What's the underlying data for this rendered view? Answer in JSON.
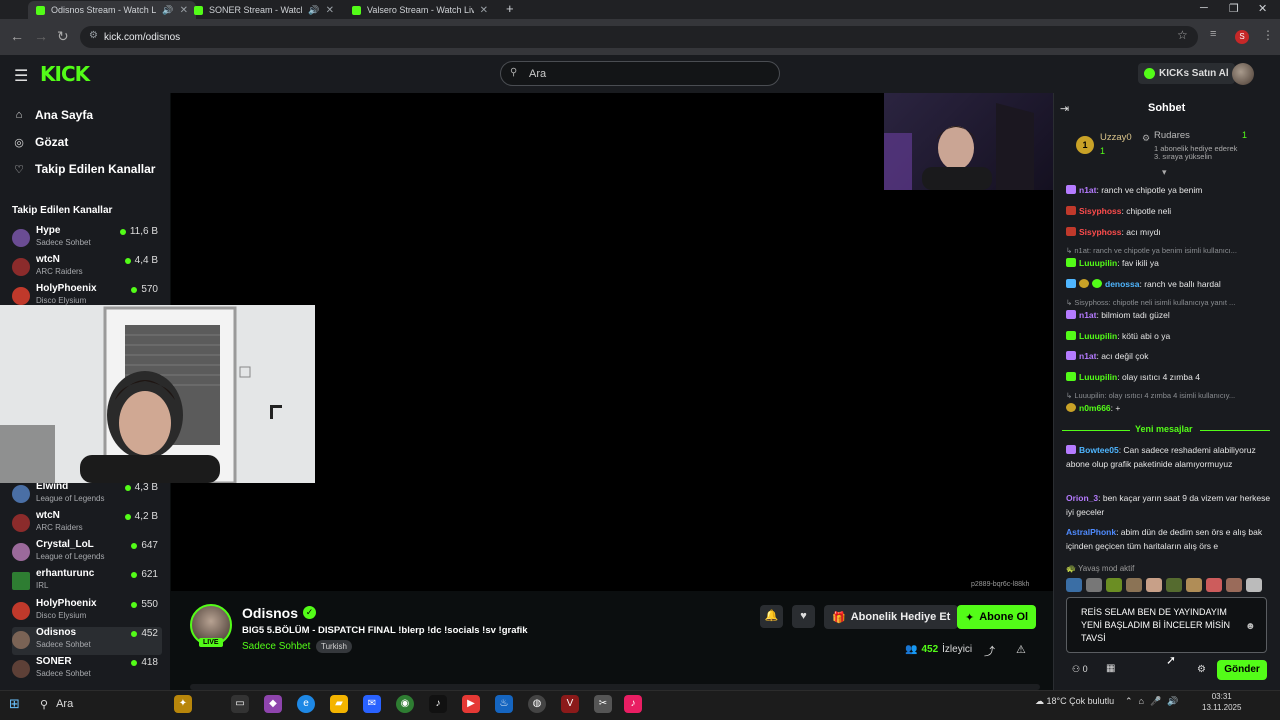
{
  "browser": {
    "tabs": [
      {
        "title": "Odisnos Stream - Watch Live"
      },
      {
        "title": "SONER Stream - Watch Live"
      },
      {
        "title": "Valsero Stream - Watch Live on"
      }
    ],
    "url": "kick.com/odisnos",
    "profile_initial": "S"
  },
  "header": {
    "logo": "KICK",
    "search_placeholder": "Ara",
    "kicks_button": "KICKs Satın Al"
  },
  "sidebar": {
    "nav": [
      {
        "label": "Ana Sayfa",
        "icon": "home-icon"
      },
      {
        "label": "Gözat",
        "icon": "compass-icon"
      },
      {
        "label": "Takip Edilen Kanallar",
        "icon": "heart-icon"
      }
    ],
    "followed_title": "Takip Edilen Kanallar",
    "channels": [
      {
        "name": "Hype",
        "category": "Sadece Sohbet",
        "viewers": "11,6 B"
      },
      {
        "name": "wtcN",
        "category": "ARC Raiders",
        "viewers": "4,4 B"
      },
      {
        "name": "HolyPhoenix",
        "category": "Disco Elysium",
        "viewers": "570"
      },
      {
        "name": "Elwind",
        "category": "League of Legends",
        "viewers": "4,3 B"
      },
      {
        "name": "wtcN",
        "category": "ARC Raiders",
        "viewers": "4,2 B"
      },
      {
        "name": "Crystal_LoL",
        "category": "League of Legends",
        "viewers": "647"
      },
      {
        "name": "erhanturunc",
        "category": "IRL",
        "viewers": "621"
      },
      {
        "name": "HolyPhoenix",
        "category": "Disco Elysium",
        "viewers": "550"
      },
      {
        "name": "Odisnos",
        "category": "Sadece Sohbet",
        "viewers": "452"
      },
      {
        "name": "SONER",
        "category": "Sadece Sohbet",
        "viewers": "418"
      }
    ]
  },
  "player": {
    "stream_id": "p2889-bqr6c-l88kh"
  },
  "stream": {
    "name": "Odisnos",
    "live": "LIVE",
    "title": "BIG5 5.BÖLÜM - DISPATCH FINAL !blerp !dc !socials !sv !grafik",
    "category": "Sadece Sohbet",
    "language": "Turkish",
    "gift_label": "Abonelik Hediye Et",
    "subscribe_label": "Abone Ol",
    "viewer_count": "452",
    "viewer_label": "İzleyici"
  },
  "chat": {
    "title": "Sohbet",
    "pinned": {
      "left_user": "Uzzay0",
      "left_count": "1",
      "right_user": "Rudares",
      "right_count": "1",
      "right_line1": "1 abonelik hediye ederek",
      "right_line2": "3. sıraya yükselin"
    },
    "messages": [
      {
        "user": "n1at",
        "text": ": ranch ve chipotle ya benim",
        "color": "#b57bff",
        "badge": "#b57bff"
      },
      {
        "user": "Sisyphoss",
        "text": ": chipotle neli",
        "color": "#ff4d4d",
        "badge": "#c0392b"
      },
      {
        "user": "Sisyphoss",
        "text": ": acı mıydı",
        "color": "#ff4d4d",
        "badge": "#c0392b"
      },
      {
        "reply": "n1at: ranch ve chipotle ya benim isimli kullanıcı..."
      },
      {
        "user": "Luuupilin",
        "text": ": fav ikili ya",
        "color": "#53fc18",
        "badge": "#53fc18"
      },
      {
        "user": "denossa",
        "text": ": ranch ve ballı hardal",
        "color": "#4fb6ff",
        "badge": "#4fb6ff"
      },
      {
        "reply": "Sisyphoss: chipotle neli isimli kullanıcıya yanıt ..."
      },
      {
        "user": "n1at",
        "text": ": bilmiom tadı güzel",
        "color": "#b57bff",
        "badge": "#b57bff"
      },
      {
        "user": "Luuupilin",
        "text": ": kötü abi o ya",
        "color": "#53fc18",
        "badge": "#53fc18"
      },
      {
        "user": "n1at",
        "text": ": acı değil çok",
        "color": "#b57bff",
        "badge": "#b57bff"
      },
      {
        "user": "Luuupilin",
        "text": ": olay ısıtıcı 4 zımba 4",
        "color": "#53fc18",
        "badge": "#53fc18"
      },
      {
        "reply": "Luuupilin: olay ısıtıcı 4 zımba 4 isimli kullanıcıy..."
      },
      {
        "user": "n0m666",
        "text": ": +",
        "color": "#53fc18",
        "badge": "#c9a227"
      }
    ],
    "new_messages_label": "Yeni mesajlar",
    "new_messages": [
      {
        "user": "Bowtee05",
        "text": ": Can sadece reshademi alabiliyoruz abone olup grafik paketinide alamıyormuyuz",
        "color": "#4fb6ff",
        "badge": "#b57bff"
      },
      {
        "user": "Orion_3",
        "text": ": ben kaçar yarın saat 9 da vizem var herkese iyi geceler",
        "color": "#b57bff",
        "badge": ""
      },
      {
        "user": "AstralPhonk",
        "text": ": abim dün de dedim sen örs e alış bak içinden geçicen tüm haritaların alış örs e",
        "color": "#4f8bff",
        "badge": ""
      }
    ],
    "slow_mode": "Yavaş mod aktif",
    "input_value": "REİS SELAM BEN DE YAYINDAYIM YENİ BAŞLADIM Bİ İNCELER MİSİN TAVSİ",
    "points": "0",
    "send_label": "Gönder"
  },
  "taskbar": {
    "search_label": "Ara",
    "weather": "18°C  Çok bulutlu",
    "time": "03:31",
    "date": "13.11.2025"
  }
}
